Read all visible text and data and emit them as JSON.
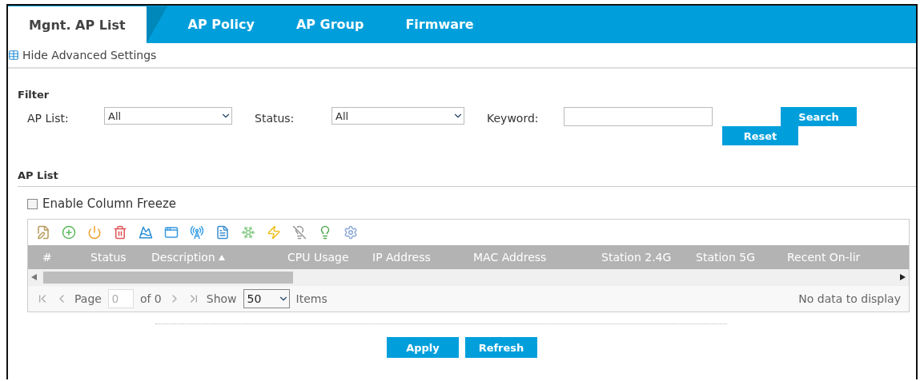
{
  "tabs": [
    {
      "label": "Mgnt. AP List",
      "selected": true
    },
    {
      "label": "AP Policy",
      "selected": false
    },
    {
      "label": "AP Group",
      "selected": false
    },
    {
      "label": "Firmware",
      "selected": false
    }
  ],
  "advanced_link": "Hide Advanced Settings",
  "filter": {
    "title": "Filter",
    "fields": [
      {
        "kind": "select",
        "label": "AP List:",
        "value": "All"
      },
      {
        "kind": "select",
        "label": "Status:",
        "value": "All"
      },
      {
        "kind": "text",
        "label": "Keyword:"
      }
    ],
    "buttons": [
      "Search",
      "Reset"
    ]
  },
  "ap_list": {
    "title": "AP List",
    "column_freeze": {
      "label": "Enable Column Freeze",
      "checked": false
    },
    "columns": [
      {
        "label": "#",
        "sorted": false
      },
      {
        "label": "Status",
        "sorted": false
      },
      {
        "label": "Description",
        "sorted": true
      },
      {
        "label": "CPU Usage",
        "sorted": false
      },
      {
        "label": "IP Address",
        "sorted": false
      },
      {
        "label": "MAC Address",
        "sorted": false
      },
      {
        "label": "Station 2.4G",
        "sorted": false
      },
      {
        "label": "Station 5G",
        "sorted": false
      },
      {
        "label": "Recent On-lir",
        "sorted": false
      }
    ],
    "pager": {
      "page_label": "Page",
      "page": "0",
      "of": "of 0",
      "show_label": "Show",
      "per_page": "50",
      "items_label": "Items",
      "empty": "No data to display"
    }
  },
  "buttons": [
    "Apply",
    "Refresh"
  ]
}
